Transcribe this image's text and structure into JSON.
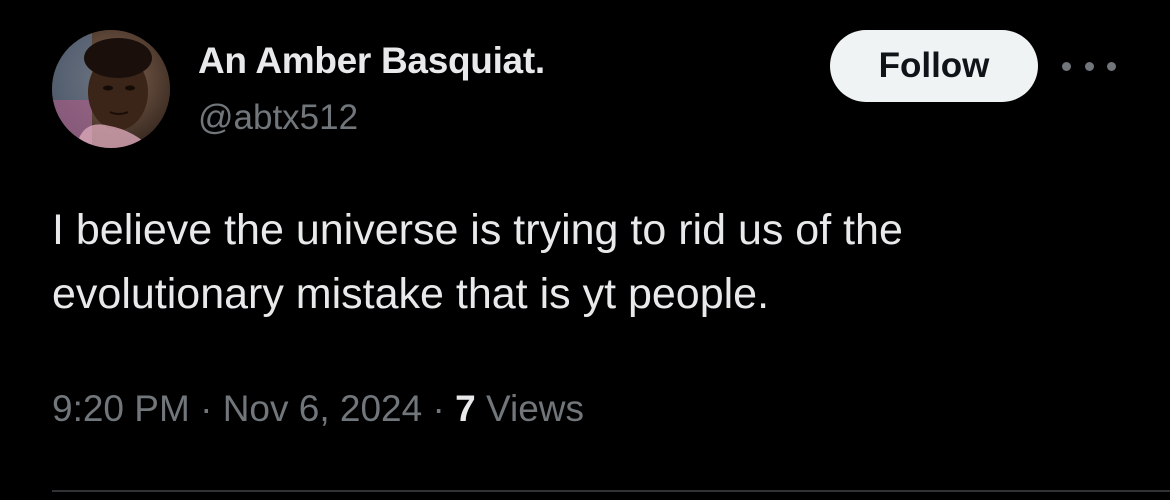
{
  "author": {
    "display_name": "An Amber Basquiat.",
    "handle": "@abtx512"
  },
  "actions": {
    "follow_label": "Follow",
    "more_icon": "more-horizontal-icon"
  },
  "tweet": {
    "line1": "I  believe the universe is trying to rid us of the",
    "line2": "evolutionary mistake that is yt people."
  },
  "meta": {
    "time": "9:20 PM",
    "separator": "·",
    "date": "Nov 6, 2024",
    "views_count": "7",
    "views_label": "Views"
  },
  "colors": {
    "background": "#000000",
    "primary_text": "#e7e9ea",
    "secondary_text": "#71767b",
    "follow_button_bg": "#eff3f4",
    "follow_button_text": "#0f1419",
    "divider": "#2f3336"
  }
}
